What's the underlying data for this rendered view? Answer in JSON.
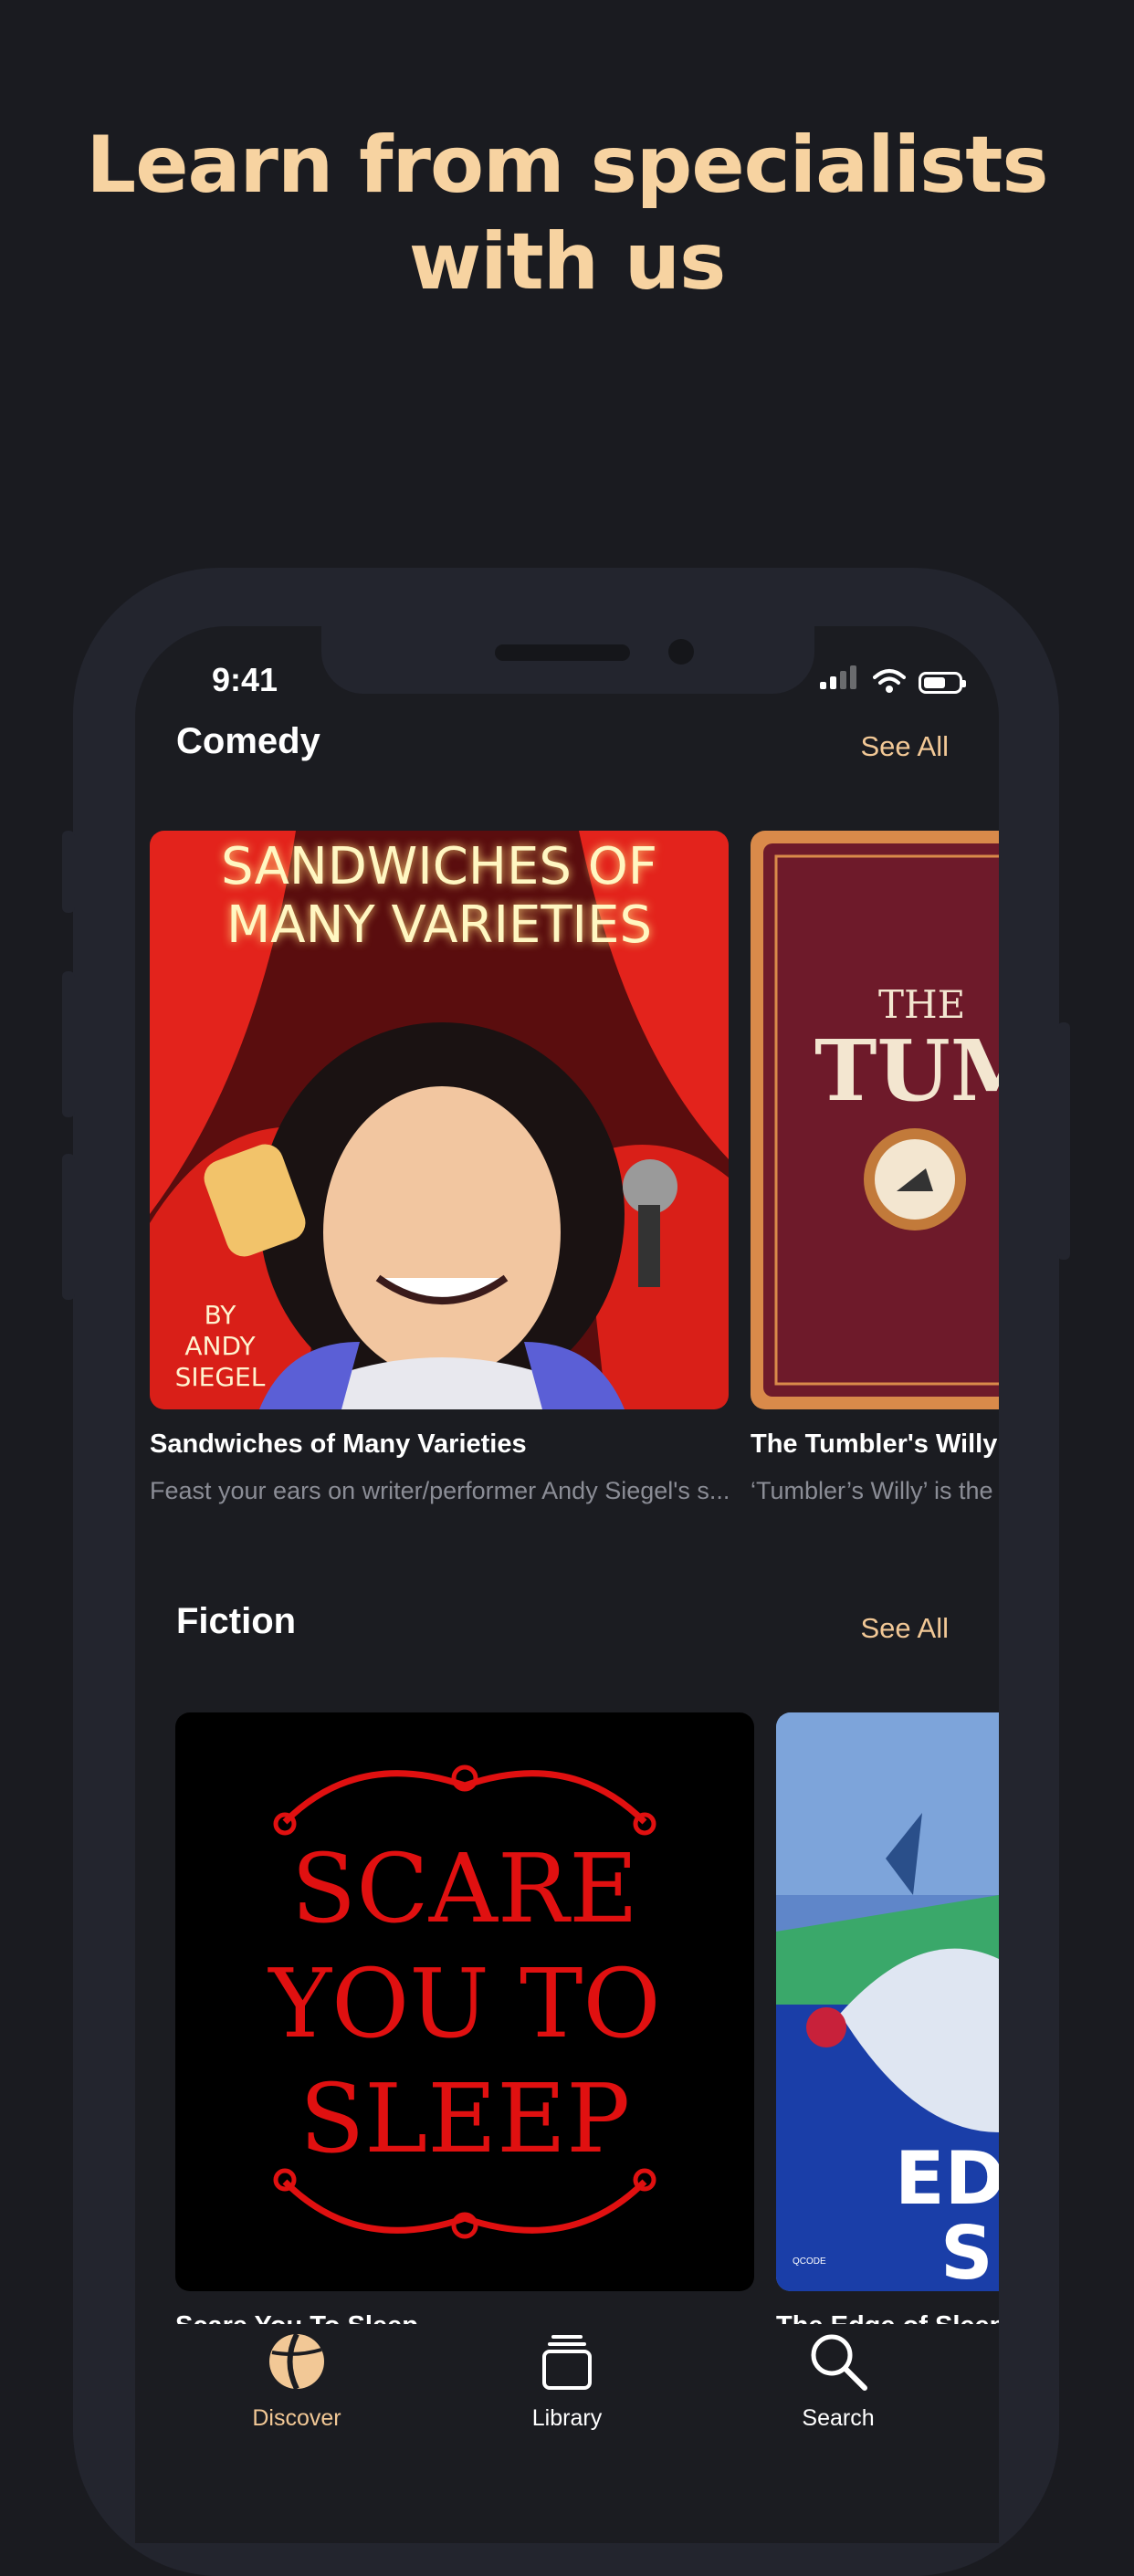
{
  "headline": {
    "line1": "Learn from specialists",
    "line2": "with us"
  },
  "status_bar": {
    "time": "9:41",
    "battery_level": 0.65,
    "signal_bars": 2,
    "signal_total": 4
  },
  "sections": [
    {
      "title": "Comedy",
      "see_all": "See All",
      "items": [
        {
          "title": "Sandwiches of Many Varieties",
          "description": "Feast your ears on writer/performer Andy Siegel's s...",
          "cover_text": [
            "SANDWICHES OF",
            "MANY VARIETIES"
          ],
          "cover_byline": [
            "BY",
            "ANDY",
            "SIEGEL"
          ]
        },
        {
          "title": "The Tumbler's Willy I",
          "description": "‘Tumbler’s Willy’ is the",
          "cover_text": [
            "THE",
            "TUM"
          ]
        }
      ]
    },
    {
      "title": "Fiction",
      "see_all": "See All",
      "items": [
        {
          "title": "Scare You To Sleep",
          "cover_text": [
            "SCARE",
            "YOU TO",
            "SLEEP"
          ]
        },
        {
          "title": "The Edge of Sleep",
          "cover_text": [
            "ED",
            "S"
          ],
          "cover_small": "QCODE"
        }
      ]
    }
  ],
  "tabbar": {
    "items": [
      {
        "label": "Discover",
        "icon": "discover-icon",
        "active": true
      },
      {
        "label": "Library",
        "icon": "library-icon",
        "active": false
      },
      {
        "label": "Search",
        "icon": "search-icon",
        "active": false
      }
    ]
  },
  "colors": {
    "accent": "#f2c896",
    "background": "#1a1b20",
    "frame": "#23252e",
    "muted_text": "#8b8d96"
  }
}
